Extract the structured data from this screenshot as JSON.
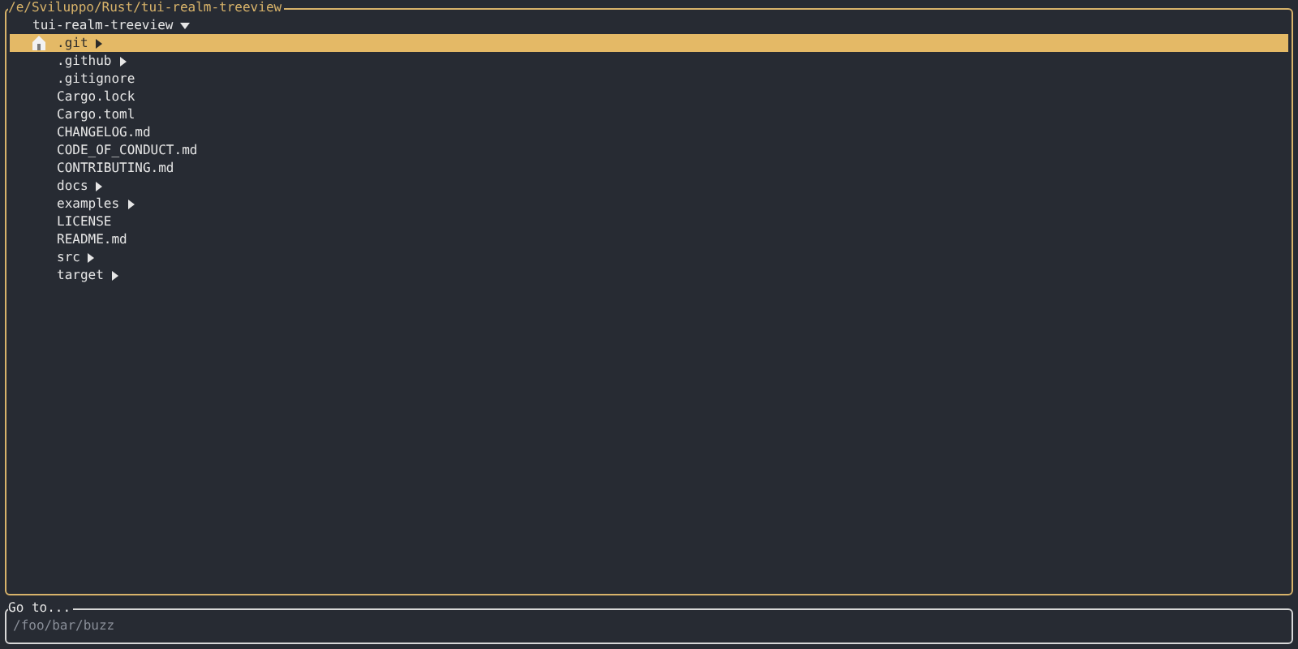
{
  "panel": {
    "title": "/e/Sviluppo/Rust/tui-realm-treeview"
  },
  "tree": {
    "label": "tui-realm-treeview",
    "kind": "dir",
    "expanded": true,
    "selected": false,
    "children": [
      {
        "label": ".git",
        "kind": "dir",
        "expanded": false,
        "selected": true
      },
      {
        "label": ".github",
        "kind": "dir",
        "expanded": false,
        "selected": false
      },
      {
        "label": ".gitignore",
        "kind": "file",
        "selected": false
      },
      {
        "label": "Cargo.lock",
        "kind": "file",
        "selected": false
      },
      {
        "label": "Cargo.toml",
        "kind": "file",
        "selected": false
      },
      {
        "label": "CHANGELOG.md",
        "kind": "file",
        "selected": false
      },
      {
        "label": "CODE_OF_CONDUCT.md",
        "kind": "file",
        "selected": false
      },
      {
        "label": "CONTRIBUTING.md",
        "kind": "file",
        "selected": false
      },
      {
        "label": "docs",
        "kind": "dir",
        "expanded": false,
        "selected": false
      },
      {
        "label": "examples",
        "kind": "dir",
        "expanded": false,
        "selected": false
      },
      {
        "label": "LICENSE",
        "kind": "file",
        "selected": false
      },
      {
        "label": "README.md",
        "kind": "file",
        "selected": false
      },
      {
        "label": "src",
        "kind": "dir",
        "expanded": false,
        "selected": false
      },
      {
        "label": "target",
        "kind": "dir",
        "expanded": false,
        "selected": false
      }
    ]
  },
  "goto": {
    "title": "Go to...",
    "placeholder": "/foo/bar/buzz"
  }
}
